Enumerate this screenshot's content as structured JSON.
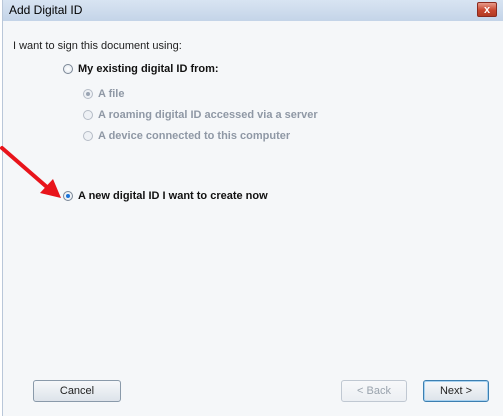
{
  "window": {
    "title": "Add Digital ID",
    "close_label": "x"
  },
  "prompt": "I want to sign this document using:",
  "options": {
    "existing": "My existing digital ID from:",
    "file": "A file",
    "roaming": "A roaming digital ID accessed via a server",
    "device": "A device connected to this computer",
    "new_id": "A new digital ID I want to create now"
  },
  "buttons": {
    "cancel": "Cancel",
    "back": "< Back",
    "next": "Next >"
  },
  "colors": {
    "annotation_arrow": "#e8141b"
  }
}
